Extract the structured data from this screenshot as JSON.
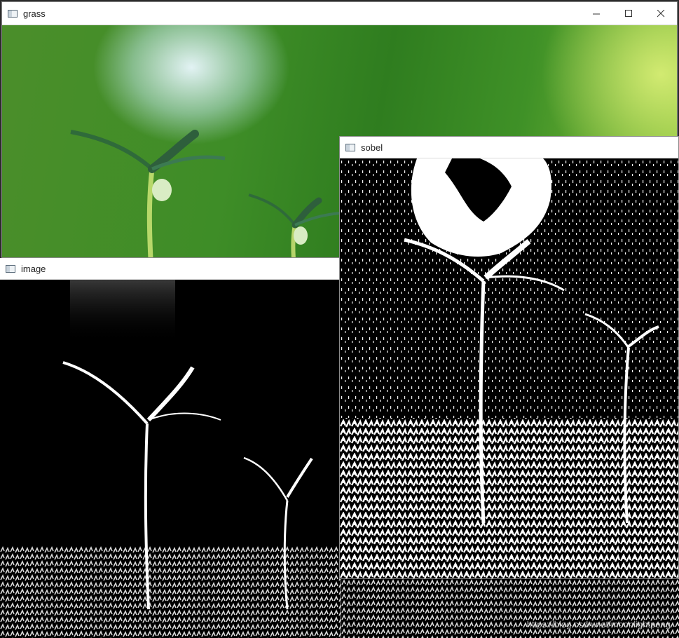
{
  "windows": {
    "grass": {
      "title": "grass"
    },
    "image": {
      "title": "image"
    },
    "sobel": {
      "title": "sobel"
    }
  },
  "watermark": "https://blog.csdn.net/moonlightpeng",
  "icons": {
    "app": "window-app-icon",
    "minimize": "minimize-icon",
    "maximize": "maximize-icon",
    "close": "close-icon"
  },
  "colors": {
    "grass_green": "#3e8d27",
    "edge_white": "#ffffff",
    "edge_black": "#000000"
  }
}
